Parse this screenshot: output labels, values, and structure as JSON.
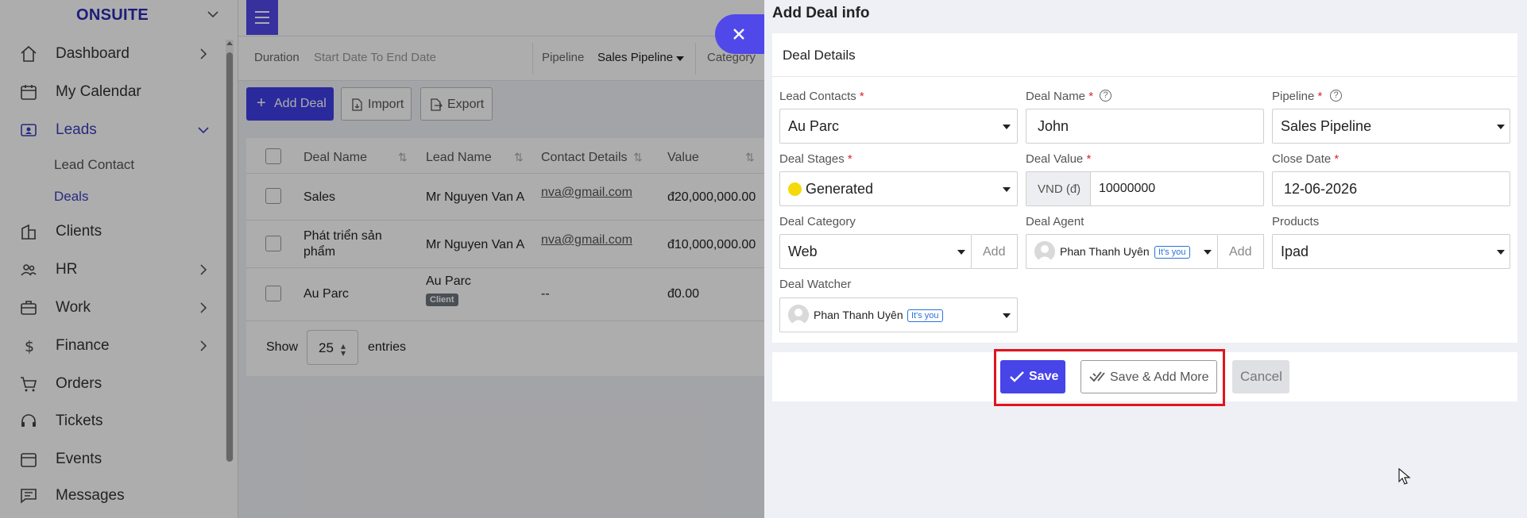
{
  "sidebar": {
    "brand": "ONSUITE",
    "items": [
      {
        "label": "Dashboard",
        "icon": "house-icon",
        "chevron": "right"
      },
      {
        "label": "My Calendar",
        "icon": "calendar-icon"
      },
      {
        "label": "Leads",
        "icon": "contact-card-icon",
        "chevron": "down",
        "active": true
      },
      {
        "label": "Clients",
        "icon": "building-icon"
      },
      {
        "label": "HR",
        "icon": "people-icon",
        "chevron": "right"
      },
      {
        "label": "Work",
        "icon": "briefcase-icon",
        "chevron": "right"
      },
      {
        "label": "Finance",
        "icon": "dollar-icon",
        "chevron": "right"
      },
      {
        "label": "Orders",
        "icon": "cart-icon"
      },
      {
        "label": "Tickets",
        "icon": "headset-icon"
      },
      {
        "label": "Events",
        "icon": "event-calendar-icon"
      },
      {
        "label": "Messages",
        "icon": "message-icon"
      }
    ],
    "subitems": [
      {
        "label": "Lead Contact"
      },
      {
        "label": "Deals",
        "active": true
      }
    ]
  },
  "filters": {
    "duration_label": "Duration",
    "duration_value": "Start Date To End Date",
    "pipeline_label": "Pipeline",
    "pipeline_value": "Sales Pipeline",
    "category_label": "Category"
  },
  "toolbar": {
    "add_deal": "Add Deal",
    "import": "Import",
    "export": "Export"
  },
  "table": {
    "columns": [
      "Deal Name",
      "Lead Name",
      "Contact Details",
      "Value"
    ],
    "rows": [
      {
        "deal": "Sales",
        "lead": "Mr Nguyen Van A",
        "contact": "nva@gmail.com",
        "value": "đ20,000,000.00"
      },
      {
        "deal_line1": "Phát triển sản",
        "deal_line2": "phẩm",
        "lead": "Mr Nguyen Van A",
        "contact": "nva@gmail.com",
        "value": "đ10,000,000.00"
      },
      {
        "deal": "Au Parc",
        "lead": "Au Parc",
        "badge": "Client",
        "contact": "--",
        "value": "đ0.00"
      }
    ],
    "show_label": "Show",
    "page_size": "25",
    "entries_label": "entries"
  },
  "panel": {
    "title": "Add Deal info",
    "section": "Deal Details",
    "fields": {
      "lead_contacts": {
        "label": "Lead Contacts",
        "value": "Au Parc"
      },
      "deal_name": {
        "label": "Deal Name",
        "value": "John"
      },
      "pipeline": {
        "label": "Pipeline",
        "value": "Sales Pipeline"
      },
      "deal_stages": {
        "label": "Deal Stages",
        "value": "Generated",
        "dot_color": "#f5d90a"
      },
      "deal_value": {
        "label": "Deal Value",
        "currency": "VND (đ)",
        "value": "10000000"
      },
      "close_date": {
        "label": "Close Date",
        "value": "12-06-2026"
      },
      "deal_category": {
        "label": "Deal Category",
        "value": "Web",
        "add": "Add"
      },
      "deal_agent": {
        "label": "Deal Agent",
        "value": "Phan Thanh Uyên",
        "tag": "It's you",
        "add": "Add"
      },
      "products": {
        "label": "Products",
        "value": "Ipad"
      },
      "deal_watcher": {
        "label": "Deal Watcher",
        "value": "Phan Thanh Uyên",
        "tag": "It's you"
      }
    },
    "required_mark": "*",
    "buttons": {
      "save": "Save",
      "save_more": "Save & Add More",
      "cancel": "Cancel"
    }
  },
  "colors": {
    "accent": "#5148ea",
    "highlight": "#e0141e"
  }
}
